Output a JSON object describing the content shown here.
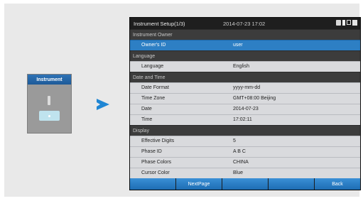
{
  "instrument_card": {
    "label": "Instrument"
  },
  "screen": {
    "title": "Instrument Setup(1/3)",
    "datetime": "2014-07-23 17:02",
    "status_icons": [
      "lock-icon",
      "usb-icon",
      "sd-card-icon",
      "battery-icon"
    ]
  },
  "sections": [
    {
      "title": "Instrument Owner",
      "rows": [
        {
          "key": "Owner's ID",
          "value": "user",
          "selected": true
        }
      ]
    },
    {
      "title": "Language",
      "rows": [
        {
          "key": "Language",
          "value": "English"
        }
      ]
    },
    {
      "title": "Date and Time",
      "rows": [
        {
          "key": "Date Format",
          "value": "yyyy-mm-dd"
        },
        {
          "key": "Time Zone",
          "value": "GMT+08:00 Beijing"
        },
        {
          "key": "Date",
          "value": "2014-07-23"
        },
        {
          "key": "Time",
          "value": "17:02:11"
        }
      ]
    },
    {
      "title": "Display",
      "rows": [
        {
          "key": "Effective Digits",
          "value": "5"
        },
        {
          "key": "Phase ID",
          "value": "A B C"
        },
        {
          "key": "Phase Colors",
          "value": "CHINA"
        },
        {
          "key": "Cursor Color",
          "value": "Blue"
        }
      ]
    }
  ],
  "footer": {
    "buttons": [
      "",
      "NextPage",
      "",
      "",
      "Back"
    ]
  },
  "colors": {
    "selected_row": "#2d7fc4",
    "section_bg": "#3c3c3c",
    "arrow": "#1f86d4"
  }
}
